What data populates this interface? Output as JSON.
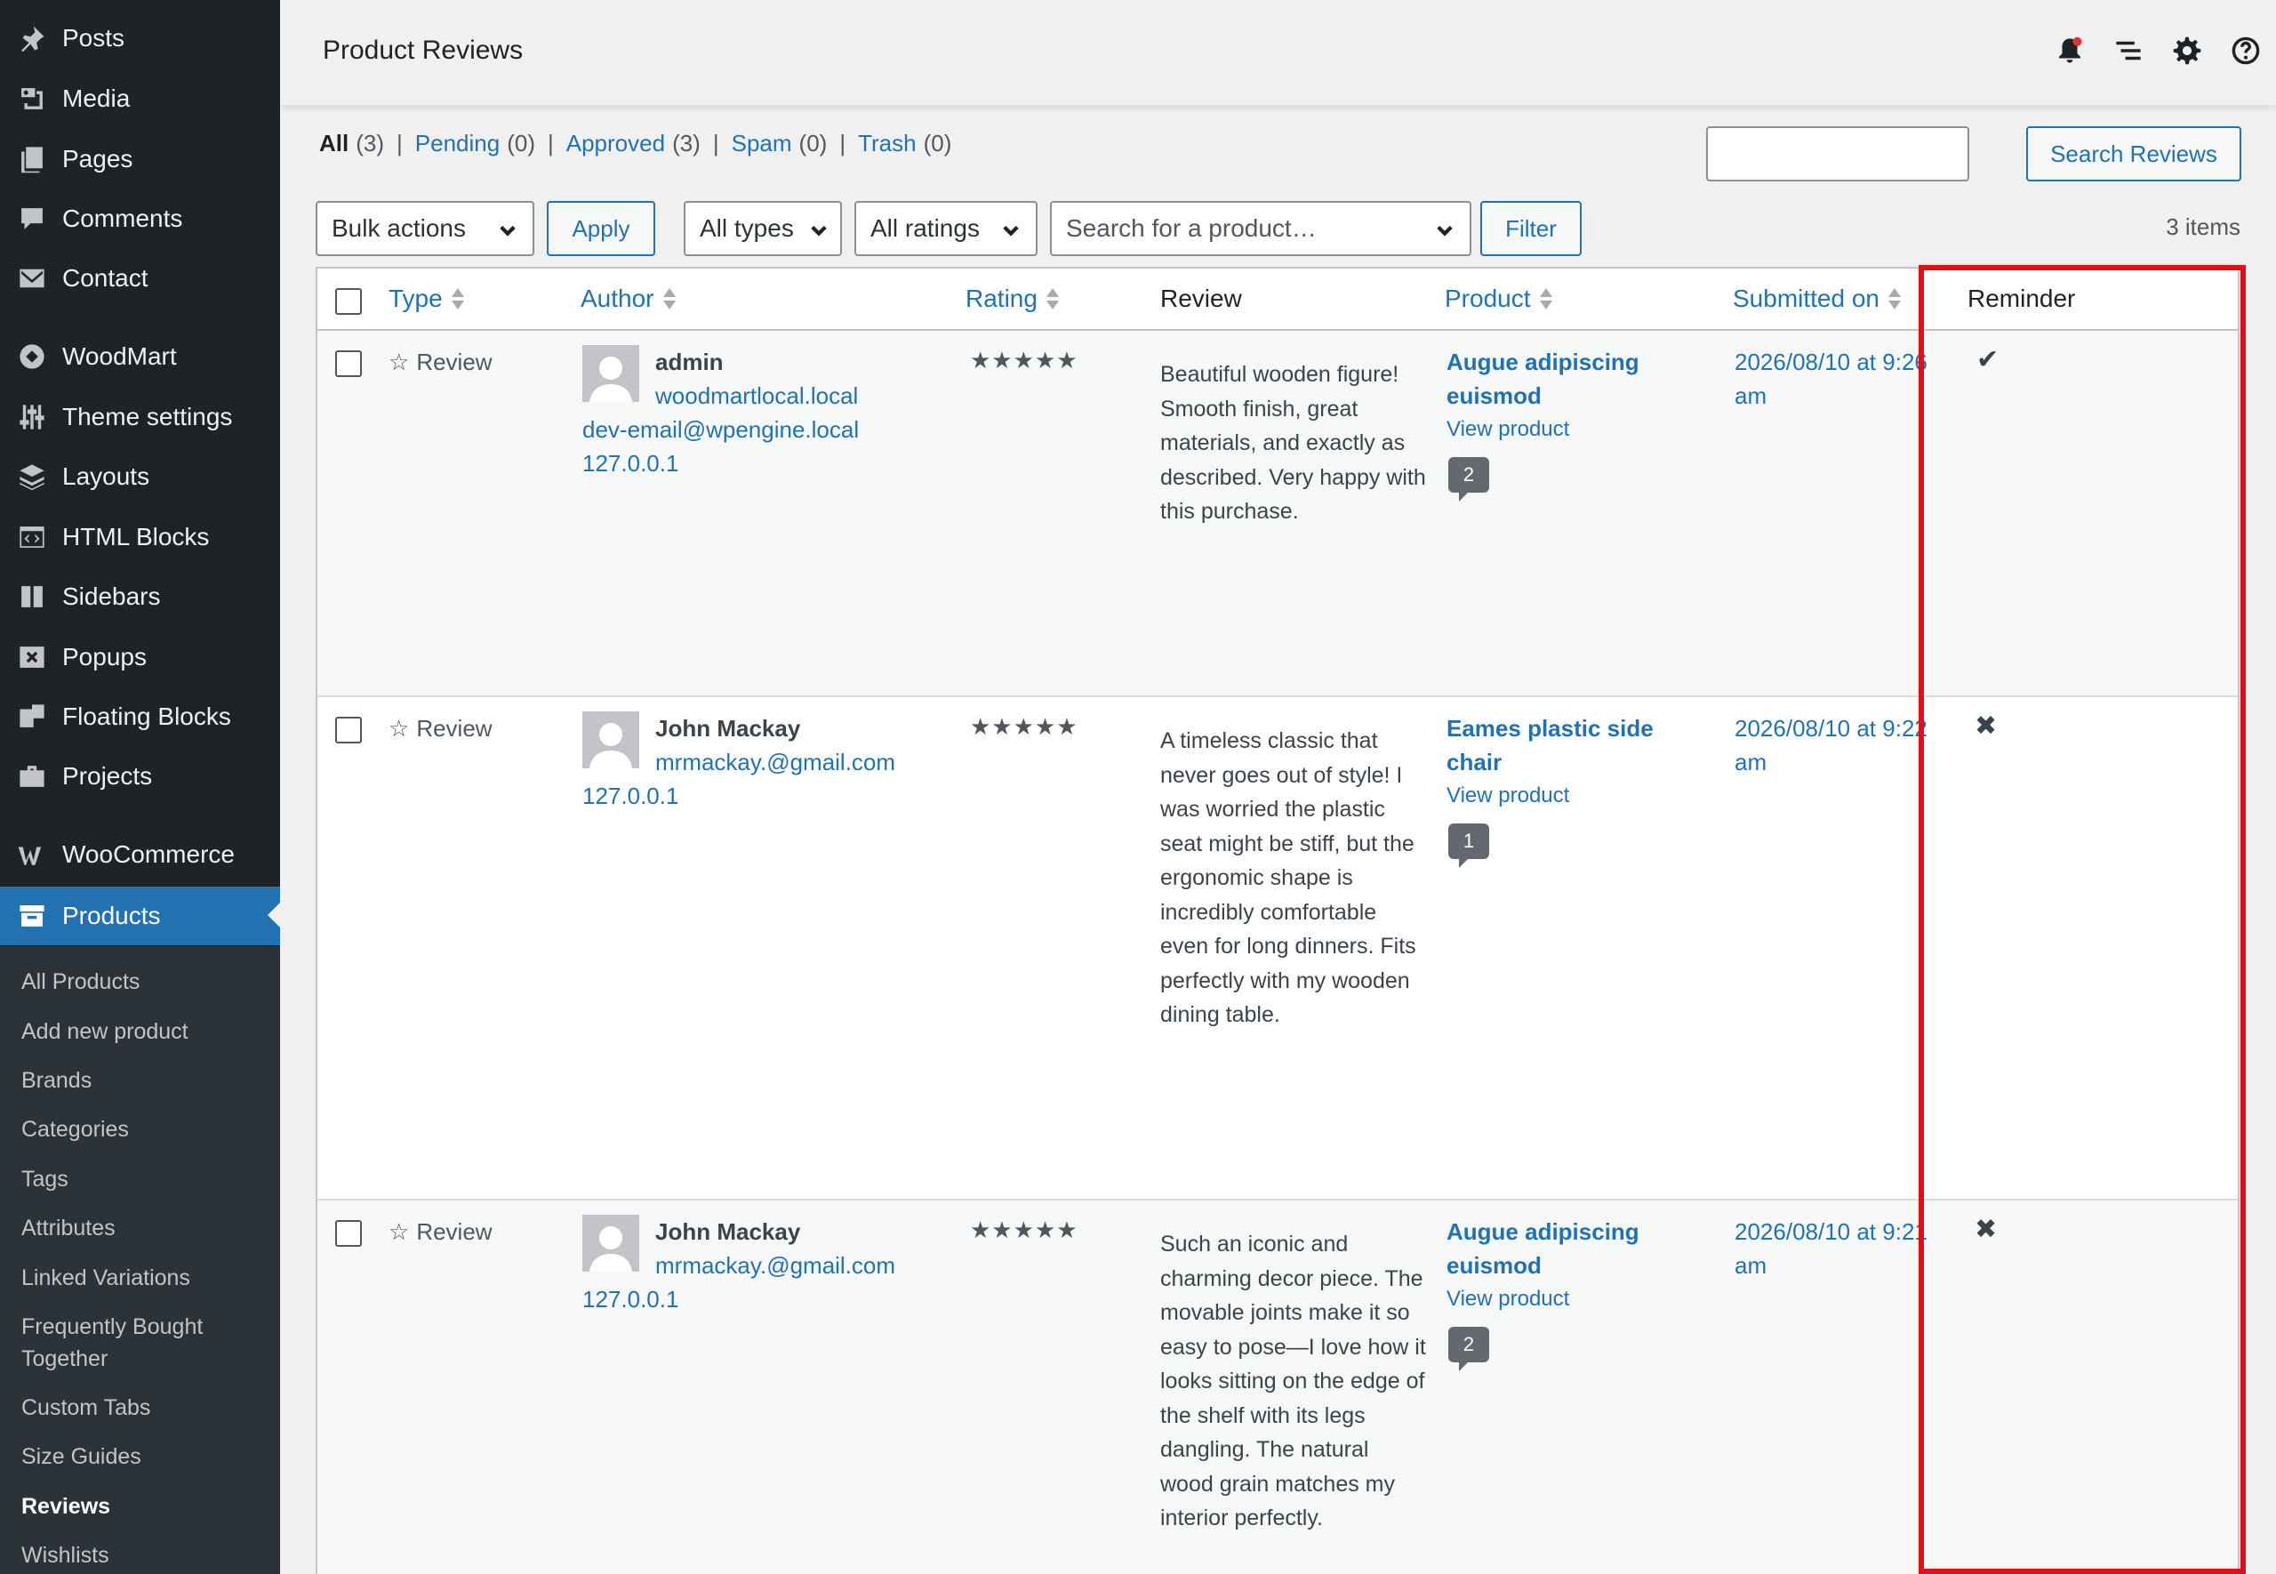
{
  "sidebar": {
    "items": [
      {
        "label": "Posts",
        "icon": "pin-icon"
      },
      {
        "label": "Media",
        "icon": "media-icon"
      },
      {
        "label": "Pages",
        "icon": "pages-icon"
      },
      {
        "label": "Comments",
        "icon": "comment-icon"
      },
      {
        "label": "Contact",
        "icon": "mail-icon"
      },
      {
        "label": "WoodMart",
        "icon": "woodmart-icon"
      },
      {
        "label": "Theme settings",
        "icon": "sliders-icon"
      },
      {
        "label": "Layouts",
        "icon": "layers-icon"
      },
      {
        "label": "HTML Blocks",
        "icon": "code-block-icon"
      },
      {
        "label": "Sidebars",
        "icon": "sidebar-icon"
      },
      {
        "label": "Popups",
        "icon": "popup-icon"
      },
      {
        "label": "Floating Blocks",
        "icon": "floating-icon"
      },
      {
        "label": "Projects",
        "icon": "briefcase-icon"
      },
      {
        "label": "WooCommerce",
        "icon": "woo-icon"
      },
      {
        "label": "Products",
        "icon": "archive-icon"
      }
    ],
    "submenu": [
      "All Products",
      "Add new product",
      "Brands",
      "Categories",
      "Tags",
      "Attributes",
      "Linked Variations",
      "Frequently Bought Together",
      "Custom Tabs",
      "Size Guides",
      "Reviews",
      "Wishlists"
    ],
    "current_submenu": "Reviews"
  },
  "header": {
    "title": "Product Reviews",
    "icons": [
      "bell-icon",
      "list-icon",
      "gear-icon",
      "help-icon"
    ]
  },
  "filters": {
    "all_label": "All",
    "all_count": "(3)",
    "pending_label": "Pending",
    "pending_count": "(0)",
    "approved_label": "Approved",
    "approved_count": "(3)",
    "spam_label": "Spam",
    "spam_count": "(0)",
    "trash_label": "Trash",
    "trash_count": "(0)",
    "separator": "|"
  },
  "search": {
    "value": "",
    "button": "Search Reviews"
  },
  "toolbar": {
    "bulk_actions": "Bulk actions",
    "apply": "Apply",
    "types": "All types",
    "ratings": "All ratings",
    "product_search": "Search for a product…",
    "filter": "Filter",
    "items_count": "3 items"
  },
  "table": {
    "columns": {
      "type": "Type",
      "author": "Author",
      "rating": "Rating",
      "review": "Review",
      "product": "Product",
      "submitted": "Submitted on",
      "reminder": "Reminder"
    },
    "rows": [
      {
        "type": "Review",
        "author_name": "admin",
        "author_site": "woodmartlocal.local",
        "author_email": "dev-email@wpengine.local",
        "author_ip": "127.0.0.1",
        "rating": "★★★★★",
        "review": "Beautiful wooden figure! Smooth finish, great materials, and exactly as described. Very happy with this purchase.",
        "product": "Augue adipiscing euismod",
        "view_product": "View product",
        "comment_count": "2",
        "submitted": "2026/08/10 at 9:26 am",
        "reminder": "✔"
      },
      {
        "type": "Review",
        "author_name": "John Mackay",
        "author_email": "mrmackay.@gmail.com",
        "author_ip": "127.0.0.1",
        "rating": "★★★★★",
        "review": "A timeless classic that never goes out of style! I was worried the plastic seat might be stiff, but the ergonomic shape is incredibly comfortable even for long dinners. Fits perfectly with my wooden dining table.",
        "product": "Eames plastic side chair",
        "view_product": "View product",
        "comment_count": "1",
        "submitted": "2026/08/10 at 9:22 am",
        "reminder": "✖"
      },
      {
        "type": "Review",
        "author_name": "John Mackay",
        "author_email": "mrmackay.@gmail.com",
        "author_ip": "127.0.0.1",
        "rating": "★★★★★",
        "review": "Such an iconic and charming decor piece. The movable joints make it so easy to pose—I love how it looks sitting on the edge of the shelf with its legs dangling. The natural wood grain matches my interior perfectly.",
        "product": "Augue adipiscing euismod",
        "view_product": "View product",
        "comment_count": "2",
        "submitted": "2026/08/10 at 9:21 am",
        "reminder": "✖"
      }
    ]
  },
  "colors": {
    "accent": "#2271b1",
    "sidebar_bg": "#1d2327",
    "highlight": "#e0101a"
  }
}
